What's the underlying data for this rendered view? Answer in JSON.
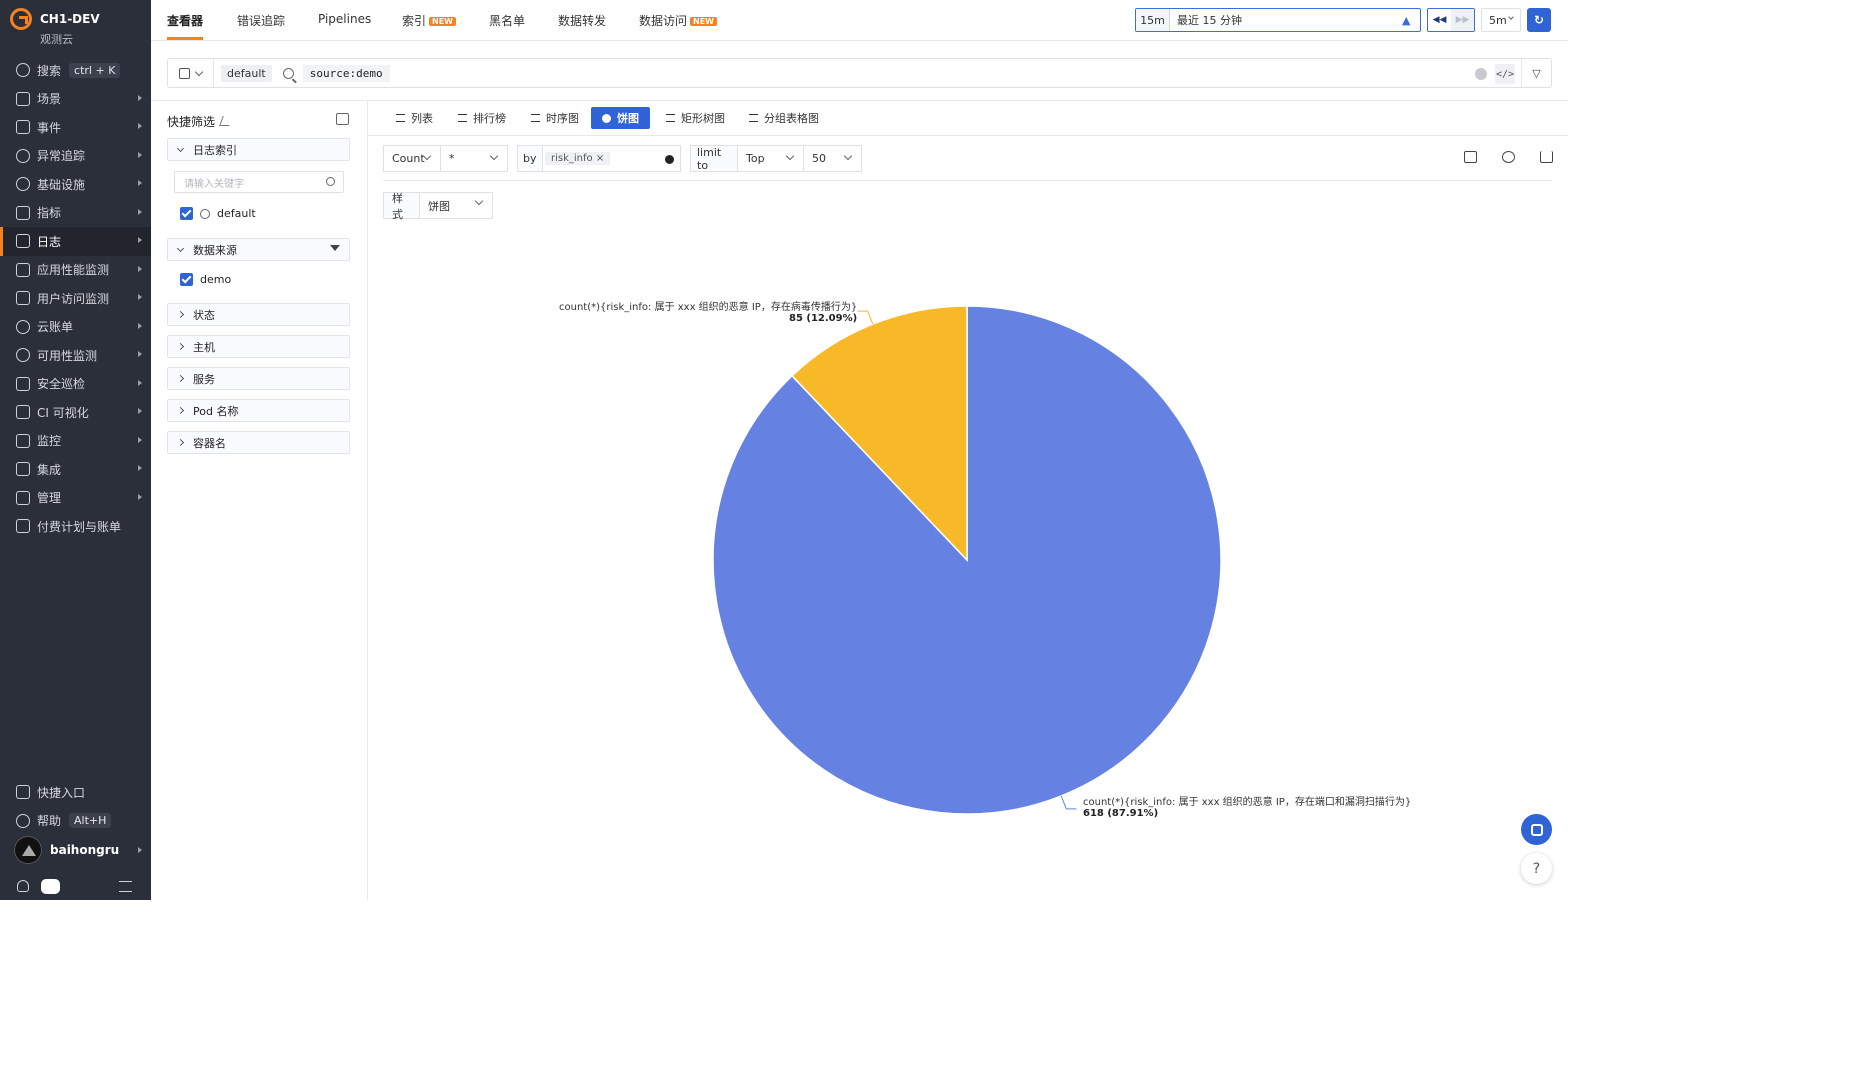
{
  "brand": {
    "name": "CH1-DEV",
    "sub": "观测云"
  },
  "sidebar": {
    "search": {
      "label": "搜索",
      "shortcut_a": "ctrl",
      "shortcut_plus": "+",
      "shortcut_b": "K"
    },
    "items": [
      {
        "label": "场景",
        "icon": "dashboard-icon"
      },
      {
        "label": "事件",
        "icon": "calendar-icon"
      },
      {
        "label": "异常追踪",
        "icon": "target-icon"
      },
      {
        "label": "基础设施",
        "icon": "nodes-icon"
      },
      {
        "label": "指标",
        "icon": "metric-icon"
      },
      {
        "label": "日志",
        "icon": "log-icon",
        "active": true
      },
      {
        "label": "应用性能监测",
        "icon": "apm-icon"
      },
      {
        "label": "用户访问监测",
        "icon": "rum-icon"
      },
      {
        "label": "云账单",
        "icon": "cloud-icon"
      },
      {
        "label": "可用性监测",
        "icon": "globe-icon"
      },
      {
        "label": "安全巡检",
        "icon": "shield-icon"
      },
      {
        "label": "CI 可视化",
        "icon": "ci-icon"
      },
      {
        "label": "监控",
        "icon": "monitor-icon"
      },
      {
        "label": "集成",
        "icon": "cube-icon"
      },
      {
        "label": "管理",
        "icon": "settings-icon"
      },
      {
        "label": "付费计划与账单",
        "icon": "bill-icon"
      }
    ],
    "quick_entry": "快捷入口",
    "help": {
      "label": "帮助",
      "shortcut": "Alt+H"
    },
    "user": "baihongru"
  },
  "topnav": {
    "tabs": [
      {
        "label": "查看器",
        "active": true,
        "new": false
      },
      {
        "label": "错误追踪",
        "new": false
      },
      {
        "label": "Pipelines",
        "new": false
      },
      {
        "label": "索引",
        "new": true
      },
      {
        "label": "黑名单",
        "new": false
      },
      {
        "label": "数据转发",
        "new": false
      },
      {
        "label": "数据访问",
        "new": true
      }
    ],
    "new_badge": "NEW",
    "time_short": "15m",
    "time_label": "最近 15 分钟",
    "refresh_interval": "5m"
  },
  "search": {
    "index": "default",
    "query": "source:demo",
    "code_label": "</>"
  },
  "filter_panel": {
    "title": "快捷筛选",
    "groups": {
      "index": "日志索引",
      "source": "数据来源",
      "status": "状态",
      "host": "主机",
      "service": "服务",
      "pod": "Pod 名称",
      "container": "容器名"
    },
    "keyword_placeholder": "请输入关键字",
    "index_value": "default",
    "source_value": "demo"
  },
  "view_tabs": [
    "列表",
    "排行榜",
    "时序图",
    "饼图",
    "矩形树图",
    "分组表格图"
  ],
  "query_builder": {
    "agg": "Count",
    "field": "*",
    "by_label": "by",
    "by_tag": "risk_info",
    "limit_label": "limit to",
    "limit_dir": "Top",
    "limit_n": "50",
    "style_label": "样式",
    "style_value": "饼图"
  },
  "chart_data": {
    "type": "pie",
    "title": "",
    "slices": [
      {
        "label": "count(*){risk_info: 属于 xxx 组织的恶意 IP，存在端口和漏洞扫描行为}",
        "value": 618,
        "percent": 87.91,
        "color": "#6582e3",
        "value_text": "618 (87.91%)"
      },
      {
        "label": "count(*){risk_info: 属于 xxx 组织的恶意 IP，存在病毒传播行为}",
        "value": 85,
        "percent": 12.09,
        "color": "#f7b928",
        "value_text": "85 (12.09%)"
      }
    ]
  },
  "colors": {
    "accent": "#f5821f",
    "primary": "#2f63d6",
    "sidebar_bg": "#2b2f3a"
  }
}
